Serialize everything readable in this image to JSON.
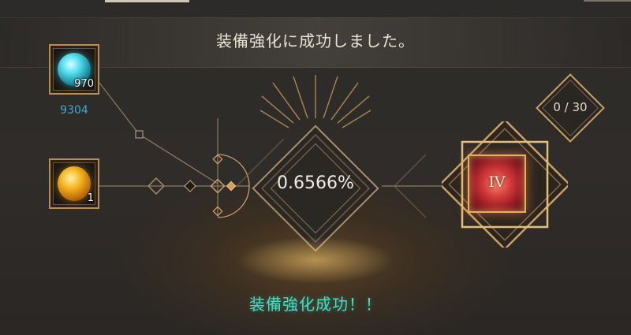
{
  "header": {
    "message": "装備強化に成功しました。"
  },
  "materials": [
    {
      "icon": "blue-crystal-icon",
      "count": "970",
      "owned": "9304"
    },
    {
      "icon": "gold-stone-icon",
      "count": "1"
    }
  ],
  "center": {
    "rate": "0.6566%"
  },
  "result": {
    "grade": "IV"
  },
  "counter": {
    "text": "0 / 30"
  },
  "footer": {
    "message": "装備強化成功！！"
  },
  "colors": {
    "gold": "#c9a064",
    "owned_count": "#3fa9d8",
    "success_text": "#3fe0c4"
  }
}
